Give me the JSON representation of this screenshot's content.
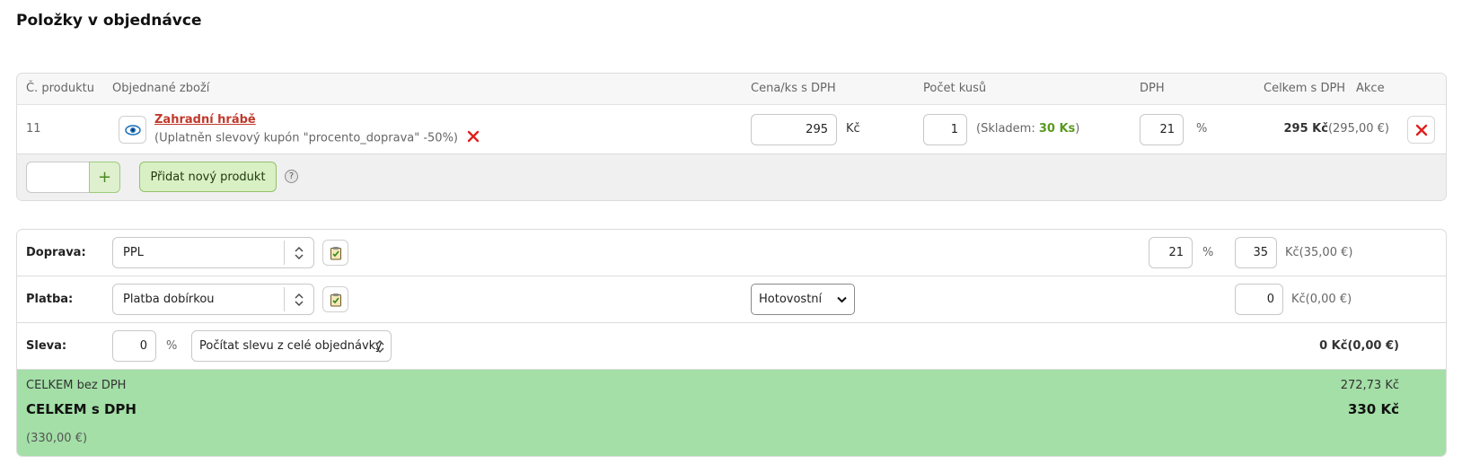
{
  "page": {
    "title": "Položky v objednávce"
  },
  "items_table": {
    "headers": {
      "product_no": "Č. produktu",
      "ordered_goods": "Objednané zboží",
      "unit_price": "Cena/ks s DPH",
      "quantity": "Počet kusů",
      "vat": "DPH",
      "total": "Celkem s DPH",
      "action": "Akce"
    },
    "rows": [
      {
        "product_no": "11",
        "name": "Zahradní hrábě",
        "coupon_note": "(Uplatněn slevový kupón \"procento_doprava\" -50%)",
        "unit_price": "295",
        "currency": "Kč",
        "quantity": "1",
        "stock_prefix": "(Skladem: ",
        "stock_value": "30 Ks",
        "stock_suffix": ")",
        "vat": "21",
        "vat_unit": "%",
        "total_czk": "295 Kč",
        "total_eur": "(295,00 €)"
      }
    ],
    "add_product_label": "Přidat nový produkt",
    "add_plus": "+",
    "help_mark": "?"
  },
  "shipping": {
    "label": "Doprava:",
    "selected": "PPL",
    "vat": "21",
    "vat_unit": "%",
    "price": "35",
    "price_suffix": "Kč(35,00 €)"
  },
  "payment": {
    "label": "Platba:",
    "selected": "Platba dobírkou",
    "type_selected": "Hotovostní",
    "price": "0",
    "price_suffix": "Kč(0,00 €)"
  },
  "discount": {
    "label": "Sleva:",
    "value": "0",
    "unit": "%",
    "mode": "Počítat slevu z celé objednávky",
    "amount": "0 Kč(0,00 €)"
  },
  "totals": {
    "without_vat_label": "CELKEM bez DPH",
    "without_vat_value": "272,73 Kč",
    "with_vat_label": "CELKEM s DPH",
    "with_vat_value": "330 Kč",
    "eur_value": "(330,00 €)"
  },
  "colors": {
    "link": "#c0392b",
    "stock": "#5a9a1f",
    "danger": "#e0201e",
    "totals_bg": "#a3dfa6",
    "add_button_bg": "#d9efc4"
  }
}
